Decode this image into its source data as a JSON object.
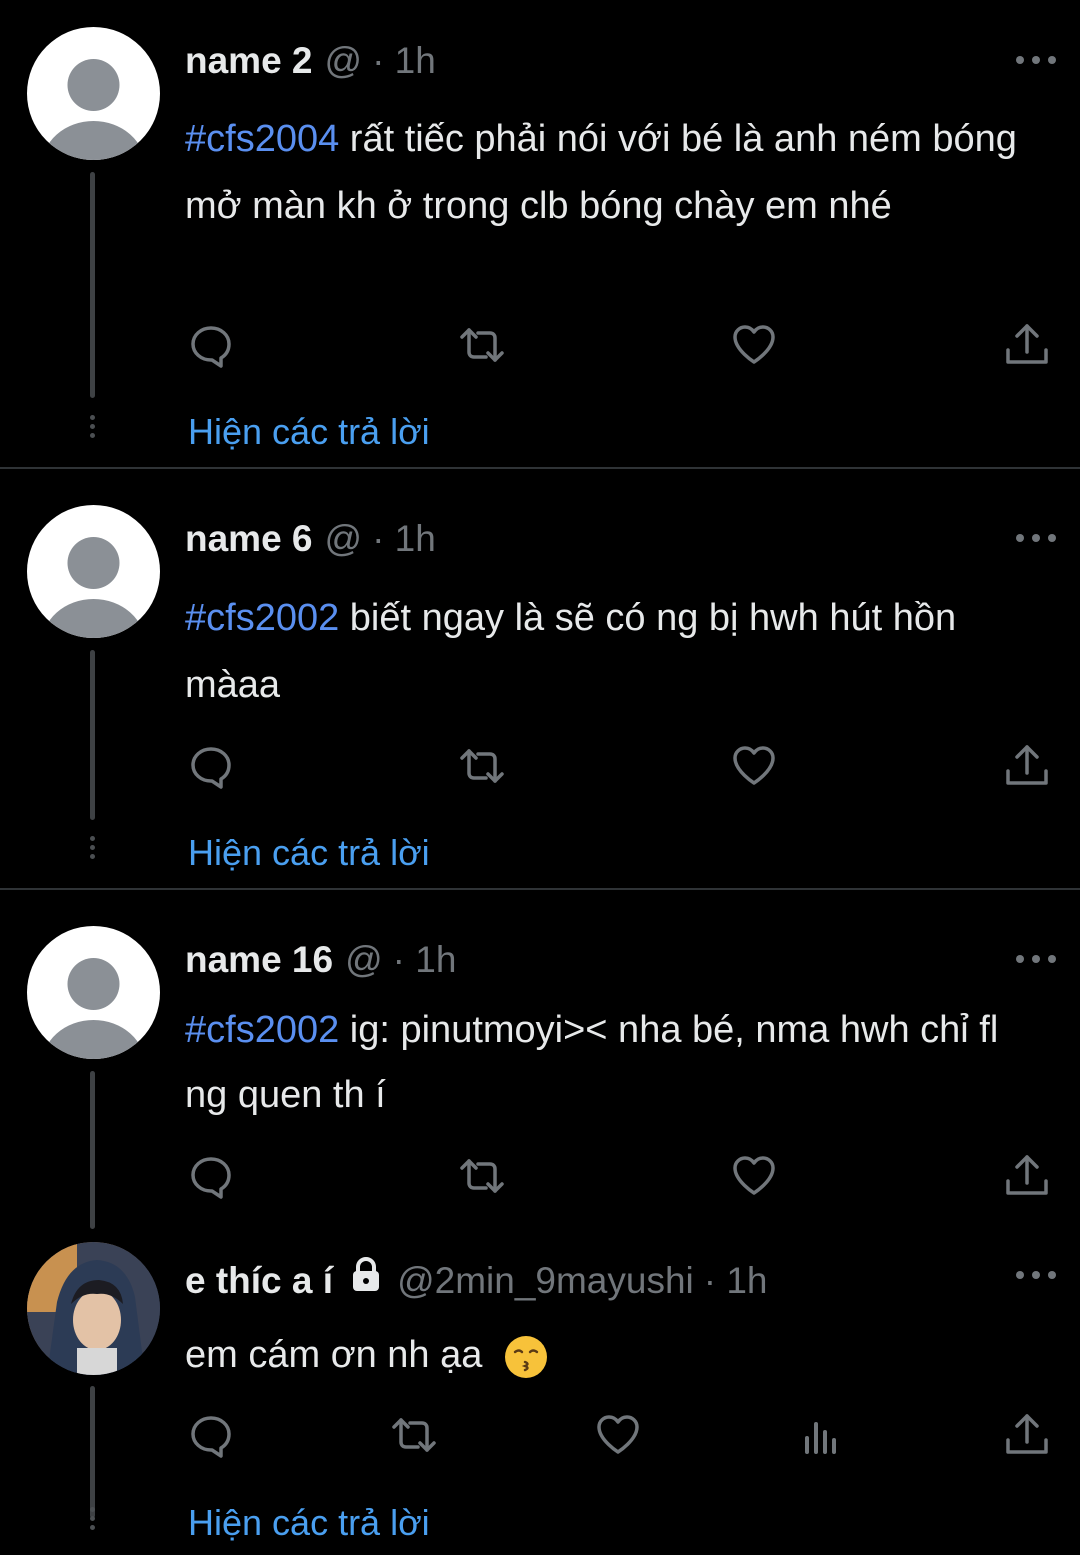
{
  "tweets": [
    {
      "name": "name 2",
      "handle": "@",
      "time": "· 1h",
      "hashtag": "#cfs2004",
      "text": " rất tiếc phải nói với bé là anh ném bóng mở màn kh ở trong clb bóng chày em nhé",
      "show_replies": "Hiện các trả lời"
    },
    {
      "name": "name 6",
      "handle": "@",
      "time": "· 1h",
      "hashtag": "#cfs2002",
      "text": " biết ngay là sẽ có ng bị hwh hút hồn màaa",
      "show_replies": "Hiện các trả lời"
    },
    {
      "name": "name 16",
      "handle": "@",
      "time": "· 1h",
      "hashtag": "#cfs2002",
      "text": " ig: pinutmoyi>< nha bé, nma hwh chỉ fl ng quen th í"
    },
    {
      "name": "e thíc a í",
      "handle": "@2min_9mayushi",
      "time": "· 1h",
      "text": "em cám ơn nh ạa",
      "emoji": "kissing-face",
      "show_replies": "Hiện các trả lời"
    }
  ],
  "colors": {
    "background": "#000000",
    "text": "#e7e9ea",
    "secondary": "#71767b",
    "link": "#4a9ff0",
    "divider": "#2f3336"
  },
  "icons": [
    "reply-icon",
    "retweet-icon",
    "like-icon",
    "views-icon",
    "share-icon",
    "more-icon",
    "lock-icon"
  ]
}
